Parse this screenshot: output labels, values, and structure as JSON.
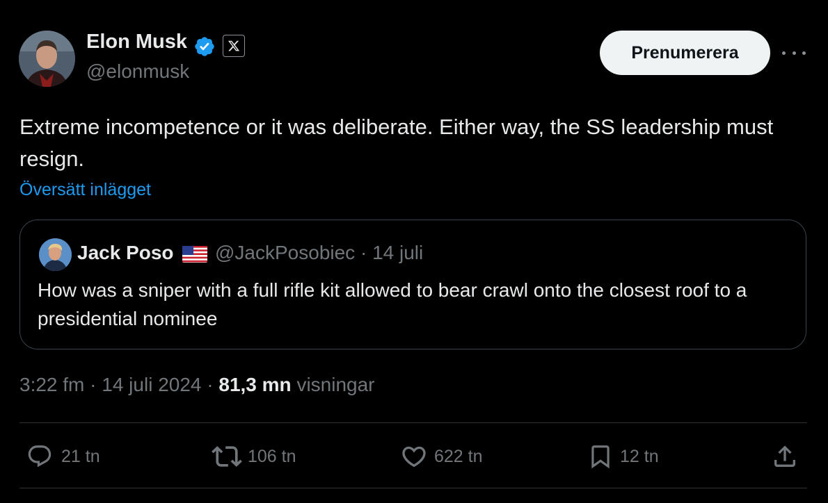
{
  "author": {
    "name": "Elon Musk",
    "handle": "@elonmusk",
    "verified_color": "#1d9bf0",
    "avatar_icon": "avatar"
  },
  "subscribe_label": "Prenumerera",
  "more_icon": "more-icon",
  "tweet": {
    "text": "Extreme incompetence or it was deliberate. Either way, the SS leadership must resign.",
    "translate_label": "Översätt inlägget"
  },
  "quote": {
    "name": "Jack Poso",
    "meta": "@JackPosobiec · 14 juli",
    "text": "How was a sniper with a full rifle kit allowed to bear crawl onto the closest roof to a presidential nominee"
  },
  "meta": {
    "time_date": "3:22 fm · 14 juli 2024 · ",
    "views_count": "81,3 mn",
    "views_label": "visningar"
  },
  "actions": {
    "replies": "21 tn",
    "reposts": "106 tn",
    "likes": "622 tn",
    "bookmarks": "12 tn"
  },
  "colors": {
    "background": "#000000",
    "text": "#e7e9ea",
    "secondary": "#71767b",
    "link": "#1d9bf0",
    "border": "#2f3336"
  }
}
